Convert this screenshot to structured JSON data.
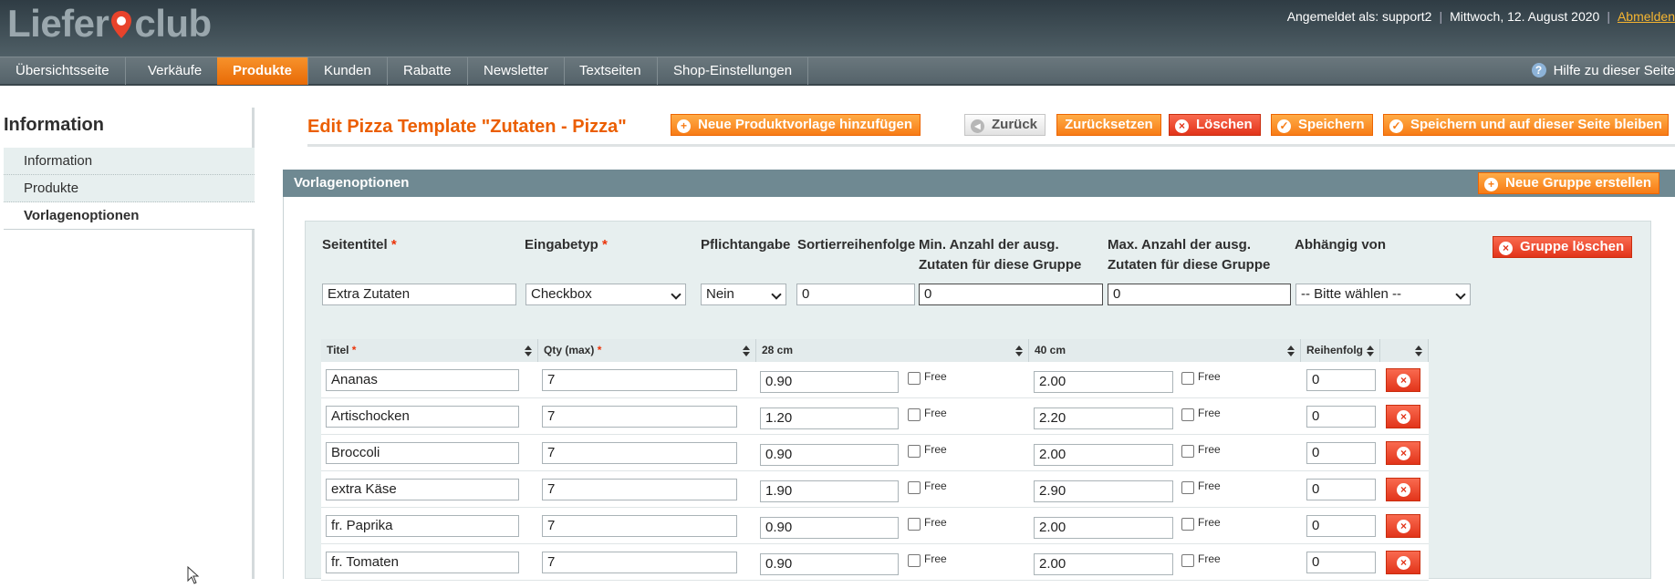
{
  "header": {
    "logo_left": "Liefer",
    "logo_right": "club",
    "user": "Angemeldet als: support2",
    "date": "Mittwoch, 12. August 2020",
    "logout": "Abmelden"
  },
  "nav": {
    "items": [
      "Übersichtsseite",
      "Verkäufe",
      "Produkte",
      "Kunden",
      "Rabatte",
      "Newsletter",
      "Textseiten",
      "Shop-Einstellungen"
    ],
    "active": "Produkte",
    "help": "Hilfe zu dieser Seite"
  },
  "sidebar": {
    "title": "Information",
    "tabs": [
      "Information",
      "Produkte",
      "Vorlagenoptionen"
    ],
    "active": "Vorlagenoptionen"
  },
  "content": {
    "title": "Edit Pizza Template \"Zutaten - Pizza\"",
    "buttons": {
      "add_template": "Neue Produktvorlage hinzufügen",
      "back": "Zurück",
      "reset": "Zurücksetzen",
      "delete": "Löschen",
      "save": "Speichern",
      "save_stay": "Speichern und auf dieser Seite bleiben"
    }
  },
  "panel": {
    "title": "Vorlagenoptionen",
    "new_group": "Neue Gruppe erstellen",
    "delete_group": "Gruppe löschen",
    "fields": {
      "seitentitel": {
        "label": "Seitentitel",
        "value": "Extra Zutaten"
      },
      "eingabetyp": {
        "label": "Eingabetyp",
        "value": "Checkbox"
      },
      "pflichtangabe": {
        "label": "Pflichtangabe",
        "value": "Nein"
      },
      "sortierreihenfolge": {
        "label": "Sortierreihenfolge",
        "value": "0"
      },
      "min_anzahl": {
        "label_1": "Min. Anzahl der ausg.",
        "label_2": "Zutaten für diese Gruppe",
        "value": "0"
      },
      "max_anzahl": {
        "label_1": "Max. Anzahl der ausg.",
        "label_2": "Zutaten für diese Gruppe",
        "value": "0"
      },
      "abhaengig": {
        "label": "Abhängig von",
        "value": "-- Bitte wählen --"
      }
    },
    "grid": {
      "columns": {
        "titel": "Titel",
        "qty": "Qty (max)",
        "size1": "28 cm",
        "size2": "40 cm",
        "order": "Reihenfolg"
      },
      "free_label": "Free",
      "rows": [
        {
          "titel": "Ananas",
          "qty": "7",
          "p28": "0.90",
          "p40": "2.00",
          "order": "0"
        },
        {
          "titel": "Artischocken",
          "qty": "7",
          "p28": "1.20",
          "p40": "2.20",
          "order": "0"
        },
        {
          "titel": "Broccoli",
          "qty": "7",
          "p28": "0.90",
          "p40": "2.00",
          "order": "0"
        },
        {
          "titel": "extra Käse",
          "qty": "7",
          "p28": "1.90",
          "p40": "2.90",
          "order": "0"
        },
        {
          "titel": "fr. Paprika",
          "qty": "7",
          "p28": "0.90",
          "p40": "2.00",
          "order": "0"
        },
        {
          "titel": "fr. Tomaten",
          "qty": "7",
          "p28": "0.90",
          "p40": "2.00",
          "order": "0"
        }
      ]
    }
  },
  "icons": {
    "logo_pin": "location-pin-icon",
    "help": "question-icon",
    "add": "plus-circle-icon",
    "back": "arrow-left-icon",
    "delete": "x-circle-icon",
    "save": "check-circle-icon"
  }
}
